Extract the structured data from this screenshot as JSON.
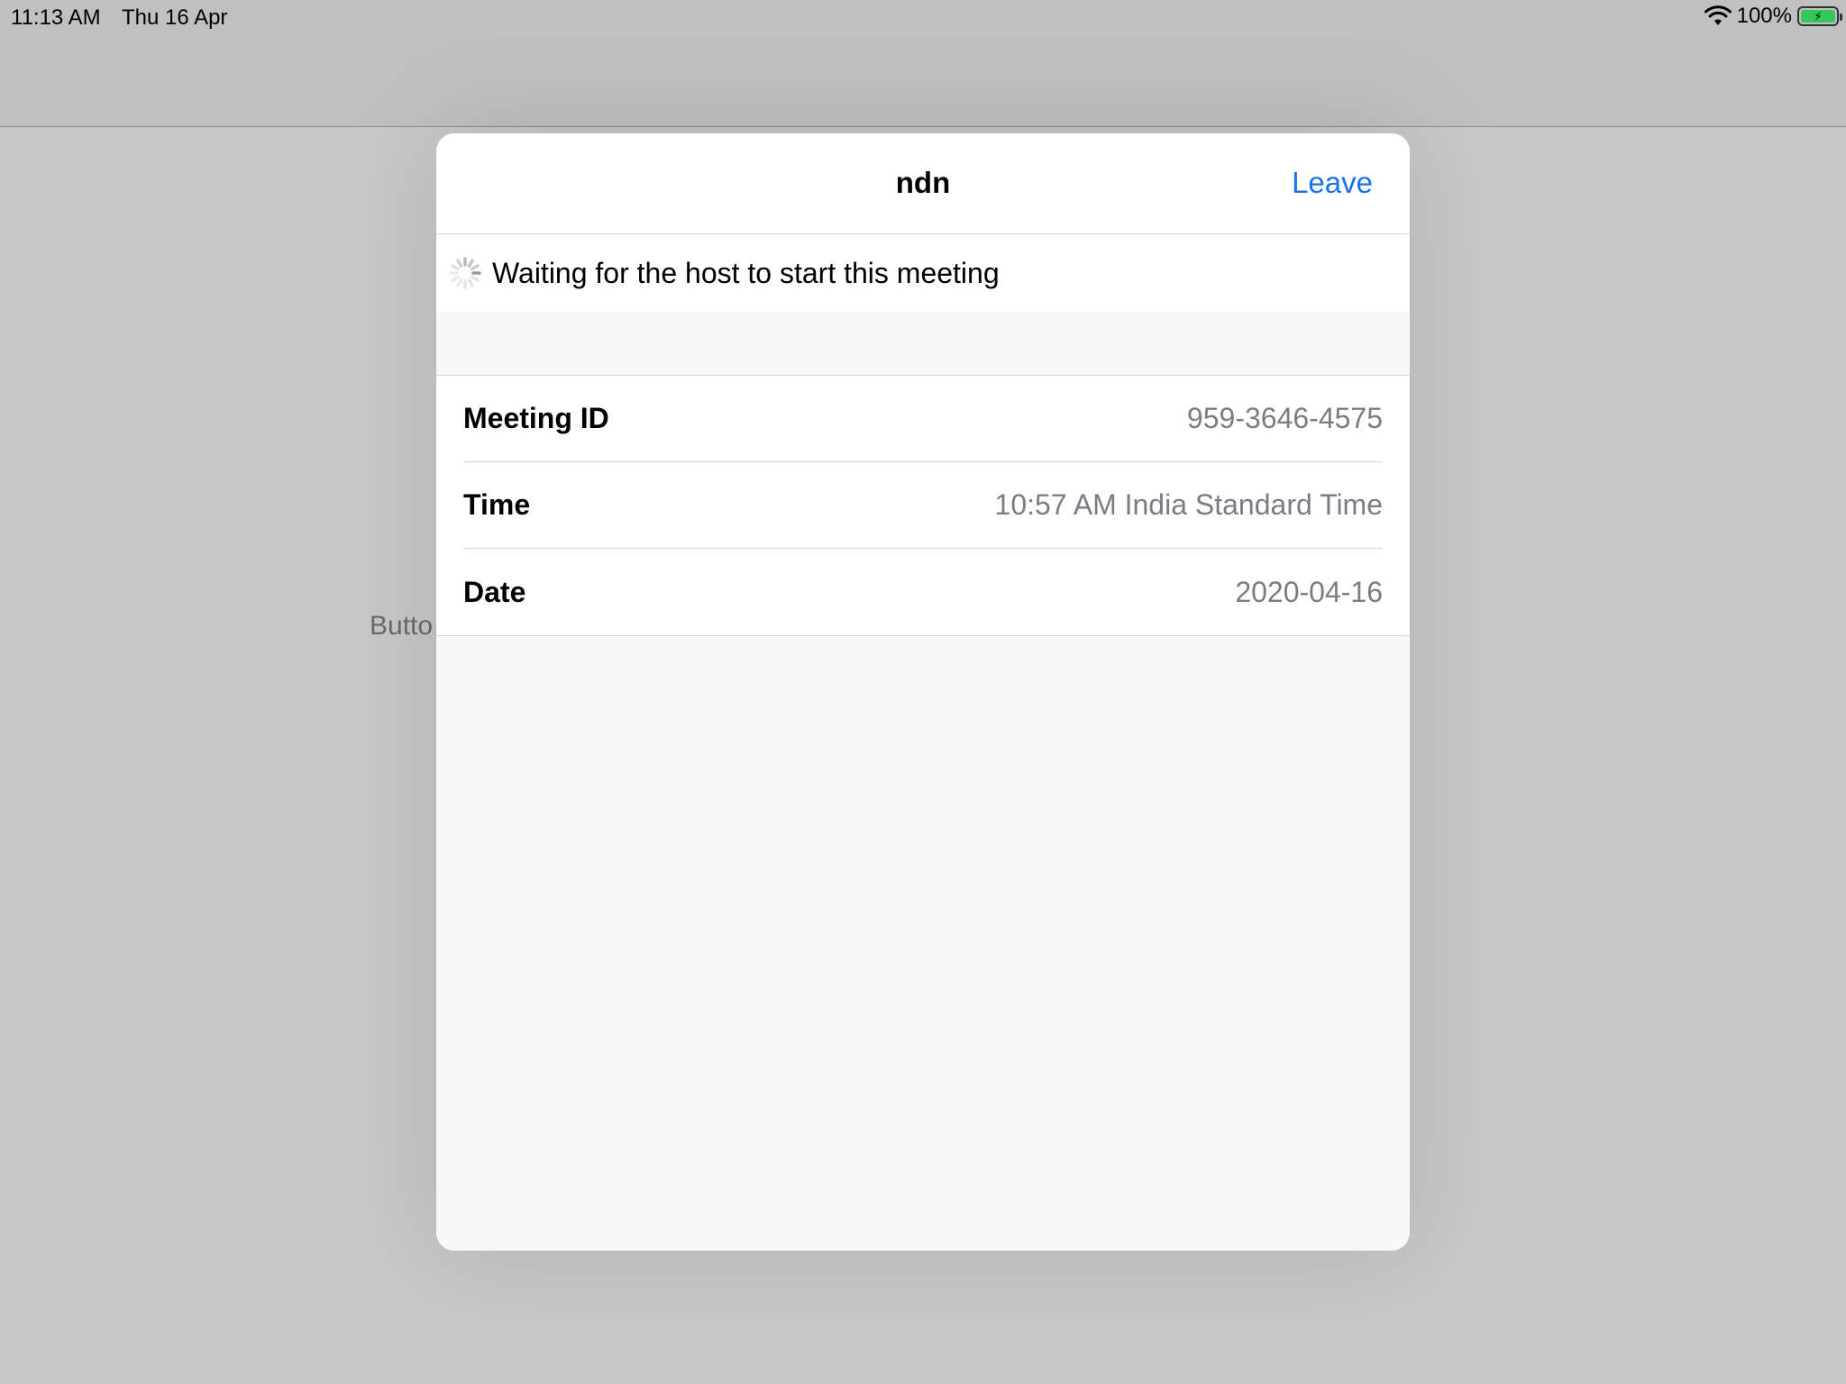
{
  "status_bar": {
    "time": "11:13 AM",
    "date": "Thu 16 Apr",
    "battery": "100%"
  },
  "background": {
    "button_label": "Butto"
  },
  "modal": {
    "title": "ndn",
    "leave_label": "Leave",
    "waiting_text": "Waiting for the host to start this meeting",
    "rows": [
      {
        "label": "Meeting ID",
        "value": "959-3646-4575"
      },
      {
        "label": "Time",
        "value": "10:57 AM India Standard Time"
      },
      {
        "label": "Date",
        "value": "2020-04-16"
      }
    ]
  },
  "colors": {
    "accent": "#1a73e8",
    "battery": "#34c759",
    "value_text": "#7c7c85"
  },
  "icons": [
    "wifi-icon",
    "battery-icon",
    "spinner-icon"
  ]
}
